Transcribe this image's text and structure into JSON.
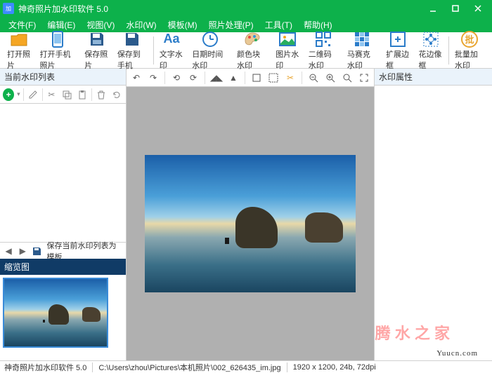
{
  "title": "神奇照片加水印软件 5.0",
  "menu": [
    "文件(F)",
    "编辑(E)",
    "视图(V)",
    "水印(W)",
    "模板(M)",
    "照片处理(P)",
    "工具(T)",
    "帮助(H)"
  ],
  "toolbar": [
    {
      "label": "打开照片",
      "icon": "folder"
    },
    {
      "label": "打开手机照片",
      "icon": "phone"
    },
    {
      "label": "保存照片",
      "icon": "save"
    },
    {
      "label": "保存到手机",
      "icon": "phone-save"
    },
    {
      "label": "文字水印",
      "icon": "text"
    },
    {
      "label": "日期时间水印",
      "icon": "clock"
    },
    {
      "label": "颜色块水印",
      "icon": "palette"
    },
    {
      "label": "图片水印",
      "icon": "image"
    },
    {
      "label": "二维码水印",
      "icon": "qr"
    },
    {
      "label": "马赛克水印",
      "icon": "mosaic"
    },
    {
      "label": "扩展边框",
      "icon": "border"
    },
    {
      "label": "花边像框",
      "icon": "flower"
    },
    {
      "label": "批量加水印",
      "icon": "batch"
    }
  ],
  "left": {
    "header": "当前水印列表",
    "save_tmpl": "保存当前水印列表为模板",
    "thumb_header": "缩览图"
  },
  "right": {
    "header": "水印属性"
  },
  "status": {
    "app": "神奇照片加水印软件 5.0",
    "path": "C:\\Users\\zhou\\Pictures\\本机照片\\002_626435_im.jpg",
    "info": "1920 x 1200, 24b, 72dpi"
  },
  "site": "Yuucn.com",
  "fx": "腾 水 之 家"
}
